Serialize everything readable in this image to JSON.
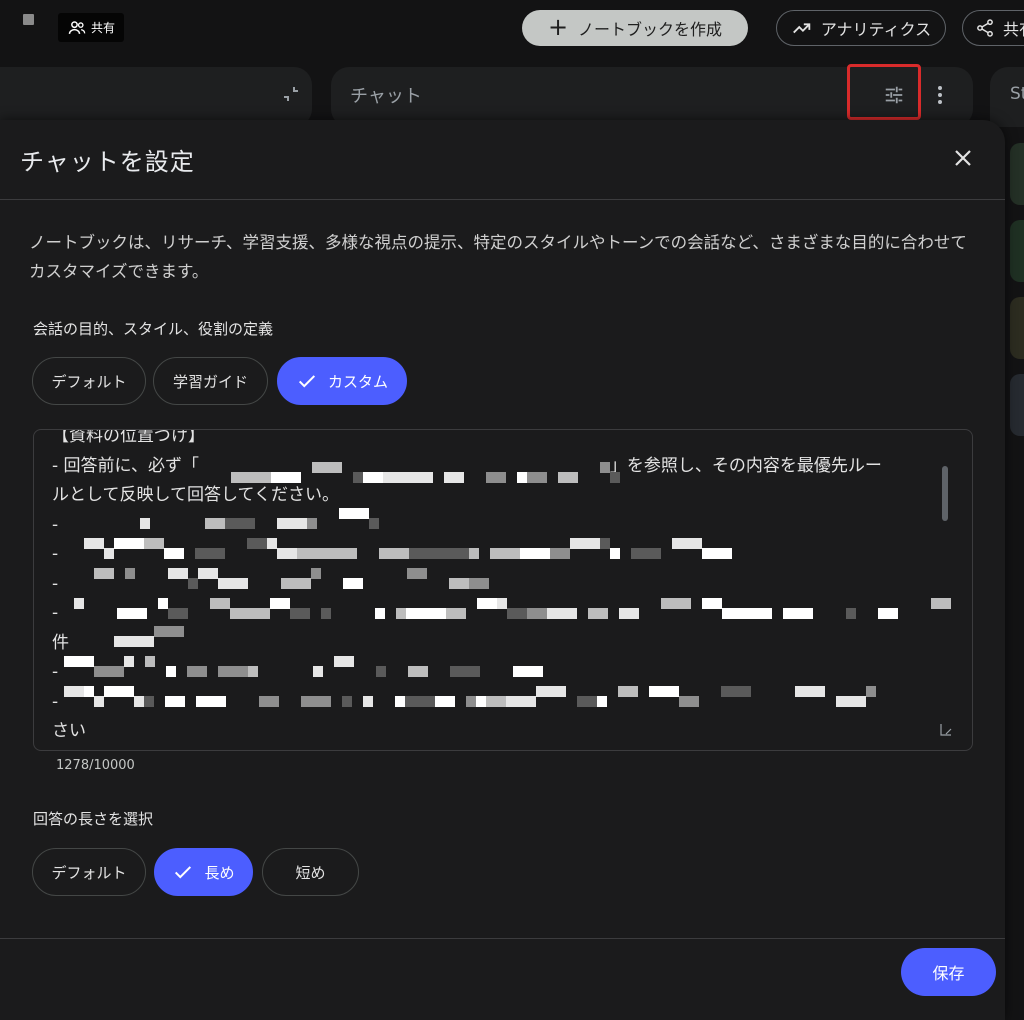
{
  "topbar": {
    "share_chip_label": "共有",
    "create_notebook": "ノートブックを作成",
    "analytics": "アナリティクス",
    "share": "共有"
  },
  "panels": {
    "chat_title": "チャット",
    "right_label": "St"
  },
  "dialog": {
    "title": "チャットを設定",
    "description": "ノートブックは、リサーチ、学習支援、多様な視点の提示、特定のスタイルやトーンでの会話など、さまざまな目的に合わせてカスタマイズできます。",
    "goal_section_label": "会話の目的、スタイル、役割の定義",
    "goal_options": [
      {
        "label": "デフォルト",
        "selected": false
      },
      {
        "label": "学習ガイド",
        "selected": false
      },
      {
        "label": "カスタム",
        "selected": true
      }
    ],
    "prompt_lines": [
      "【資料の位置づけ】",
      "- 回答前に、必ず「",
      "」を参照し、その内容を最優先ルー",
      "ルとして反映して回答してください。",
      "件",
      "さい"
    ],
    "char_counter": "1278/10000",
    "length_section_label": "回答の長さを選択",
    "length_options": [
      {
        "label": "デフォルト",
        "selected": false
      },
      {
        "label": "長め",
        "selected": true
      },
      {
        "label": "短め",
        "selected": false
      }
    ],
    "save_label": "保存"
  },
  "colors": {
    "accent": "#4c5eff",
    "highlight": "#d92b2b",
    "background": "#131314",
    "dialog_bg": "#1b1b1c"
  }
}
